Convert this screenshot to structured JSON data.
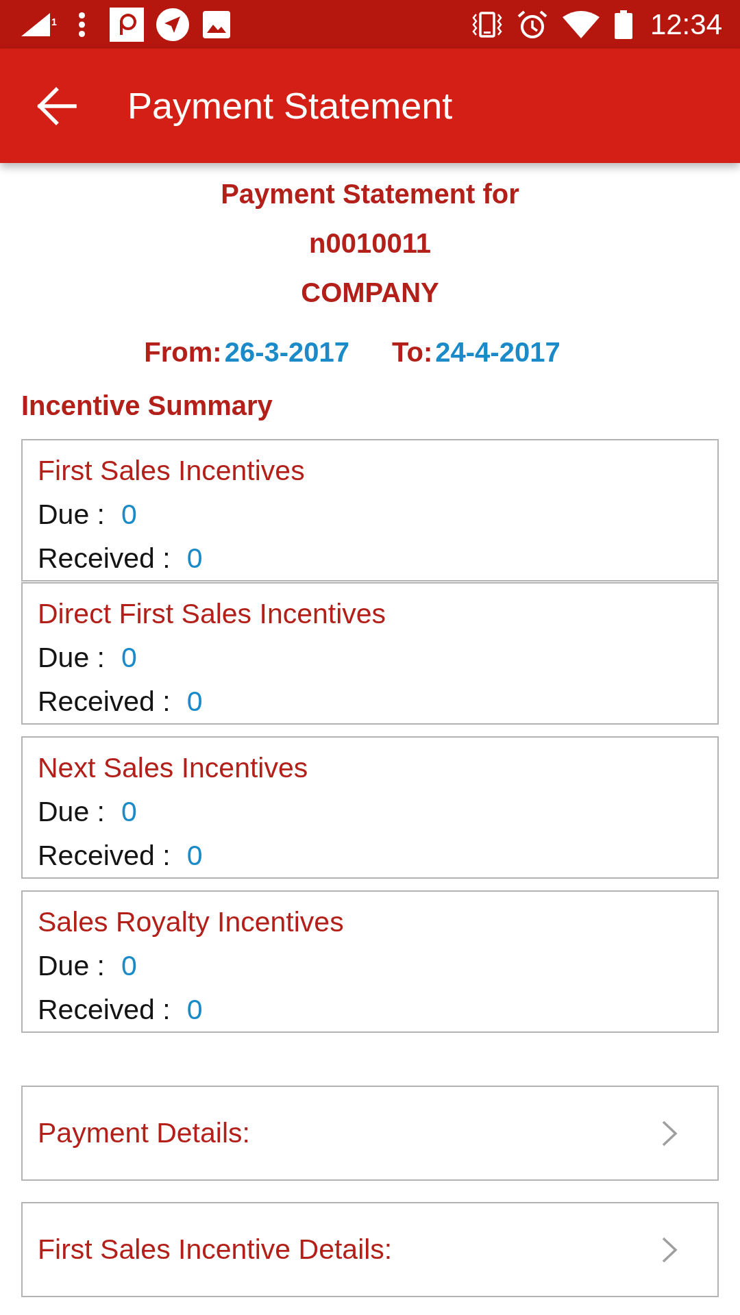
{
  "status_bar": {
    "sim_slot": "1",
    "time": "12:34"
  },
  "app_bar": {
    "title": "Payment Statement"
  },
  "statement": {
    "heading": "Payment Statement for",
    "account": "n0010011",
    "company": "COMPANY",
    "from_label": "From:",
    "from_date": "26-3-2017",
    "to_label": "To:",
    "to_date": "24-4-2017"
  },
  "incentive_summary": {
    "title": "Incentive Summary",
    "cards": [
      {
        "title": "First Sales Incentives",
        "due_label": "Due :",
        "due": "0",
        "received_label": "Received :",
        "received": "0"
      },
      {
        "title": "Direct First Sales Incentives",
        "due_label": "Due :",
        "due": "0",
        "received_label": "Received :",
        "received": "0"
      },
      {
        "title": "Next Sales Incentives",
        "due_label": "Due :",
        "due": "0",
        "received_label": "Received :",
        "received": "0"
      },
      {
        "title": "Sales Royalty Incentives",
        "due_label": "Due :",
        "due": "0",
        "received_label": "Received :",
        "received": "0"
      }
    ]
  },
  "detail_links": [
    "Payment Details:",
    "First Sales Incentive Details:"
  ]
}
